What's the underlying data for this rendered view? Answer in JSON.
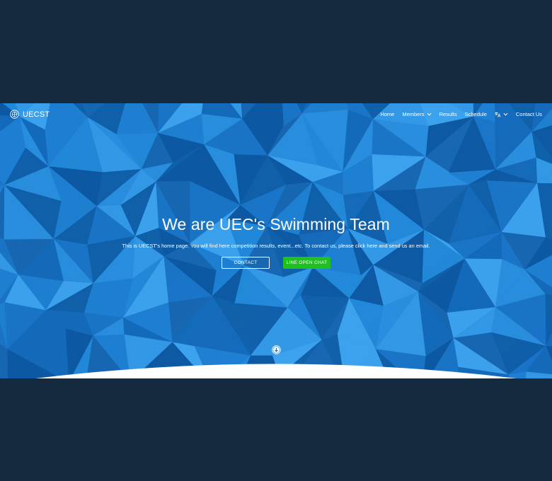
{
  "brand": {
    "name": "UECST",
    "logo_icon": "crest-icon"
  },
  "nav": {
    "items": [
      {
        "label": "Home",
        "has_dropdown": false
      },
      {
        "label": "Members",
        "has_dropdown": true
      },
      {
        "label": "Results",
        "has_dropdown": false
      },
      {
        "label": "Schedule",
        "has_dropdown": false
      },
      {
        "label": "",
        "icon": "translate-icon",
        "has_dropdown": true
      },
      {
        "label": "Contact Us",
        "has_dropdown": false
      }
    ]
  },
  "hero": {
    "title": "We are UEC's Swimming Team",
    "subtitle": "This is UECST's home page. You will find here competition results, event...etc. To contact us, please click here and send us an email.",
    "contact_button": "CONTACT",
    "line_button": "LINE OPEN CHAT",
    "scroll_icon": "arrow-down-circle-icon"
  },
  "colors": {
    "page_bg": "#142a3f",
    "hero_blue": "#1e7fd0",
    "line_green": "#1fc11f",
    "text": "#ffffff"
  }
}
